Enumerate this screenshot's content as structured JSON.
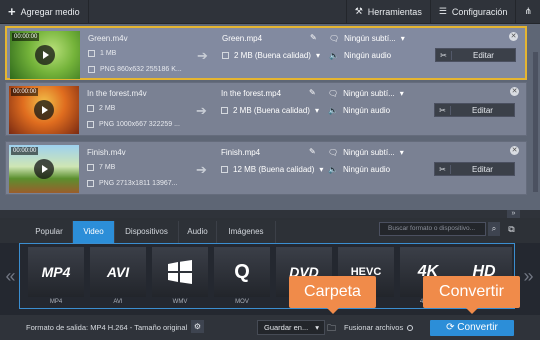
{
  "toolbar": {
    "add_media": "Agregar medio",
    "tools": "Herramientas",
    "settings": "Configuración"
  },
  "files": [
    {
      "timecode": "00:00:00",
      "name": "Green.m4v",
      "size": "1 MB",
      "info": "PNG 860x632 255186 K...",
      "out_name": "Green.mp4",
      "out_size": "2 MB (Buena calidad)",
      "subtitles": "Ningún subtí...",
      "audio": "Ningún audio",
      "edit": "Editar"
    },
    {
      "timecode": "00:00:00",
      "name": "In the forest.m4v",
      "size": "2 MB",
      "info": "PNG 1000x667 322259 ...",
      "out_name": "In the forest.mp4",
      "out_size": "2 MB (Buena calidad)",
      "subtitles": "Ningún subtí...",
      "audio": "Ningún audio",
      "edit": "Editar"
    },
    {
      "timecode": "00:00:00",
      "name": "Finish.m4v",
      "size": "7 MB",
      "info": "PNG 2713x1811 13967...",
      "out_name": "Finish.mp4",
      "out_size": "12 MB (Buena calidad)",
      "subtitles": "Ningún subtí...",
      "audio": "Ningún audio",
      "edit": "Editar"
    }
  ],
  "tabs": [
    "Popular",
    "Video",
    "Dispositivos",
    "Audio",
    "Imágenes"
  ],
  "active_tab": "Video",
  "search_placeholder": "Buscar formato o dispositivo...",
  "formats": [
    {
      "logo": "MP4",
      "caption": "MP4"
    },
    {
      "logo": "AVI",
      "caption": "AVI"
    },
    {
      "logo": "",
      "caption": "WMV"
    },
    {
      "logo": "Q",
      "caption": "MOV"
    },
    {
      "logo": "DVD",
      "caption": "DVD -"
    },
    {
      "logo": "HEVC",
      "caption": ""
    },
    {
      "logo": "4K",
      "caption": "4K Ult"
    },
    {
      "logo": "HD",
      "caption": ""
    }
  ],
  "callouts": {
    "folder": "Carpeta",
    "convert": "Convertir"
  },
  "bottom": {
    "output_format": "Formato de salida: MP4 H.264 - Tamaño original",
    "save_in": "Guardar en...",
    "merge": "Fusionar archivos",
    "convert": "Convertir"
  }
}
